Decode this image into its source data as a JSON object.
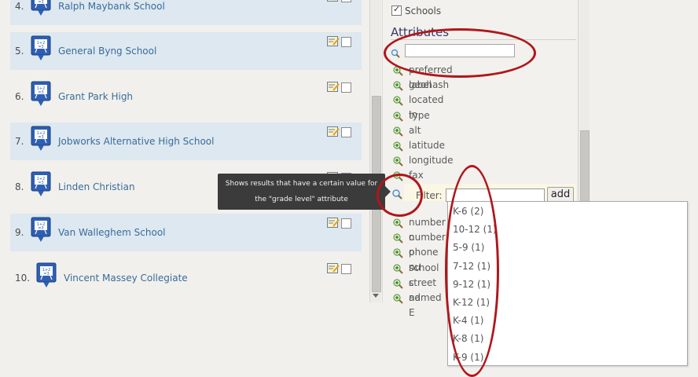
{
  "results": [
    {
      "num": "4.",
      "name": "Ralph Maybank School"
    },
    {
      "num": "5.",
      "name": "General Byng School"
    },
    {
      "num": "6.",
      "name": "Grant Park High"
    },
    {
      "num": "7.",
      "name": "Jobworks Alternative High School"
    },
    {
      "num": "8.",
      "name": "Linden Christian"
    },
    {
      "num": "9.",
      "name": "Van Walleghem School"
    },
    {
      "num": "10.",
      "name": "Vincent Massey Collegiate"
    }
  ],
  "panel": {
    "schools_label": "Schools",
    "attributes_heading": "Attributes",
    "search_value": "",
    "attributes_top": [
      "preferred label",
      "geohash",
      "located In",
      "type",
      "alt",
      "latitude",
      "longitude",
      "fax number"
    ],
    "filter_label": "Filter:",
    "filter_value": "",
    "add_label": "add",
    "attributes_bottom": [
      "number o",
      "number o",
      "phone nu",
      "school c",
      "street ad",
      "named E"
    ]
  },
  "tooltip": {
    "line1": "Shows results that have a certain value for",
    "line2": "the \"grade level\" attribute"
  },
  "dropdown_items": [
    "K-6 (2)",
    "10-12 (1)",
    "5-9 (1)",
    "7-12 (1)",
    "9-12 (1)",
    "K-12 (1)",
    "K-4 (1)",
    "K-8 (1)",
    "K-9 (1)"
  ],
  "colors": {
    "accent": "#3a6c9b",
    "annotation": "#b0161b",
    "row_shade": "#dde8f0"
  },
  "icons": {
    "school_pin": "school-pin-icon",
    "edit": "edit-note-icon",
    "attribute": "attribute-add-icon",
    "search": "magnifier-icon"
  }
}
